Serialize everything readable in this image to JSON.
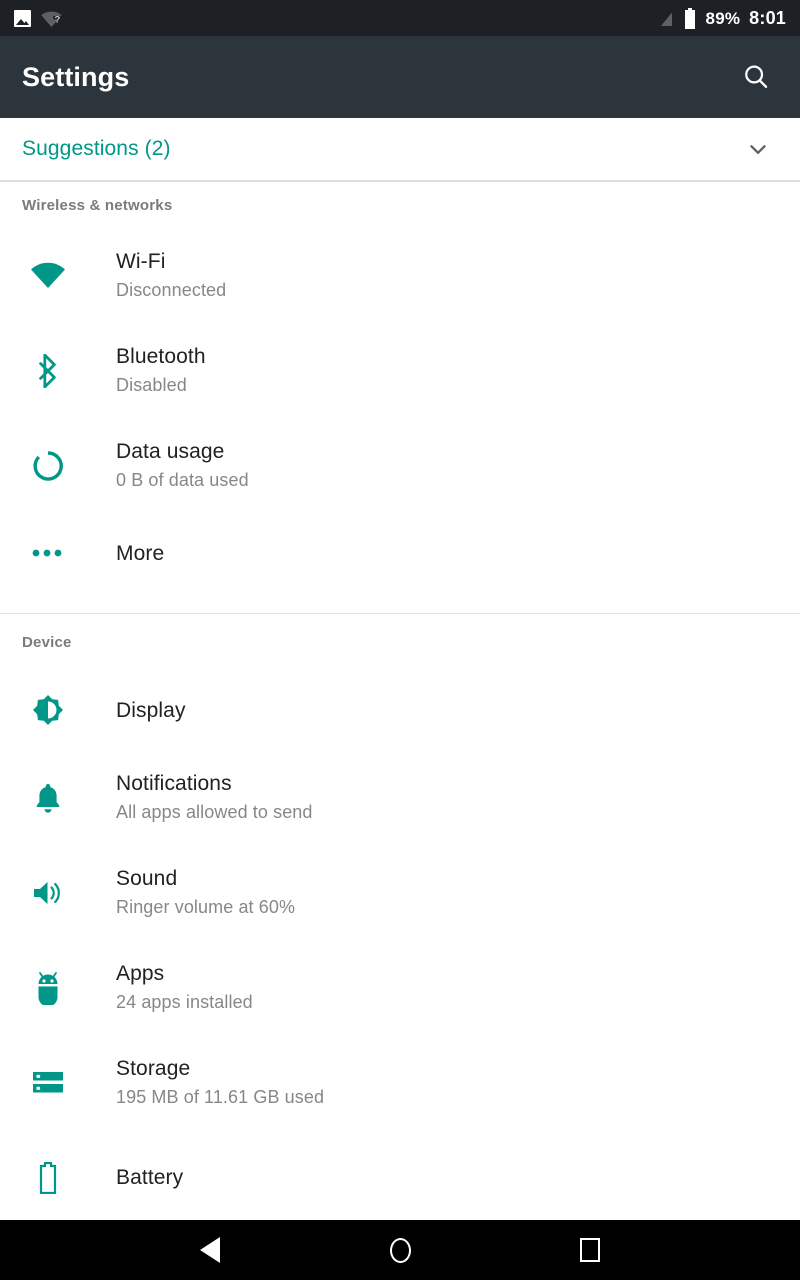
{
  "status_bar": {
    "left_icons": [
      "photo-icon",
      "wifi-question-icon"
    ],
    "right_icons": [
      "signal-off-icon",
      "battery-full-icon"
    ],
    "battery_percent": "89%",
    "clock": "8:01"
  },
  "app_bar": {
    "title": "Settings",
    "search_icon": "search-icon"
  },
  "suggestions": {
    "label": "Suggestions (2)",
    "expand_icon": "chevron-down-icon"
  },
  "sections": [
    {
      "header": "Wireless & networks",
      "items": [
        {
          "icon": "wifi-icon",
          "title": "Wi-Fi",
          "subtitle": "Disconnected"
        },
        {
          "icon": "bluetooth-icon",
          "title": "Bluetooth",
          "subtitle": "Disabled"
        },
        {
          "icon": "data-usage-icon",
          "title": "Data usage",
          "subtitle": "0 B of data used"
        },
        {
          "icon": "more-dots-icon",
          "title": "More",
          "subtitle": ""
        }
      ]
    },
    {
      "header": "Device",
      "items": [
        {
          "icon": "brightness-icon",
          "title": "Display",
          "subtitle": ""
        },
        {
          "icon": "bell-icon",
          "title": "Notifications",
          "subtitle": "All apps allowed to send"
        },
        {
          "icon": "sound-icon",
          "title": "Sound",
          "subtitle": "Ringer volume at 60%"
        },
        {
          "icon": "android-robot-icon",
          "title": "Apps",
          "subtitle": "24 apps installed"
        },
        {
          "icon": "storage-icon",
          "title": "Storage",
          "subtitle": "195 MB of 11.61 GB used"
        },
        {
          "icon": "battery-icon",
          "title": "Battery",
          "subtitle": ""
        }
      ]
    }
  ],
  "nav_bar": {
    "back": "back-triangle-icon",
    "home": "home-circle-icon",
    "recents": "recents-square-icon"
  },
  "colors": {
    "accent": "#009688",
    "app_bar_bg": "#2c343c",
    "status_bar_bg": "#1d2125",
    "title_text": "#212121",
    "subtitle_text": "#878787",
    "section_text": "#7b7b7b"
  }
}
